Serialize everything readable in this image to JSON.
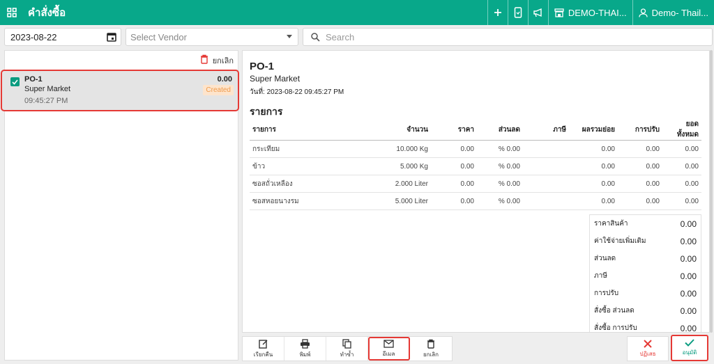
{
  "header": {
    "title": "คำสั่งซื้อ",
    "store": "DEMO-THAI...",
    "user": "Demo- Thail..."
  },
  "filters": {
    "date": "2023-08-22",
    "vendor_placeholder": "Select Vendor",
    "search_placeholder": "Search"
  },
  "list": {
    "cancel_label": "ยกเลิก",
    "items": [
      {
        "id": "PO-1",
        "vendor": "Super Market",
        "time": "09:45:27 PM",
        "amount": "0.00",
        "status": "Created"
      }
    ]
  },
  "detail": {
    "po_id": "PO-1",
    "vendor": "Super Market",
    "date": "วันที่: 2023-08-22 09:45:27 PM",
    "section_title": "รายการ",
    "columns": [
      "รายการ",
      "จำนวน",
      "ราคา",
      "ส่วนลด",
      "ภาษี",
      "ผลรวมย่อย",
      "การปรับ",
      "ยอดทั้งหมด"
    ],
    "rows": [
      [
        "กระเทียม",
        "10.000 Kg",
        "0.00",
        "% 0.00",
        "",
        "0.00",
        "0.00",
        "0.00"
      ],
      [
        "ข้าว",
        "5.000 Kg",
        "0.00",
        "% 0.00",
        "",
        "0.00",
        "0.00",
        "0.00"
      ],
      [
        "ซอสถั่วเหลือง",
        "2.000 Liter",
        "0.00",
        "% 0.00",
        "",
        "0.00",
        "0.00",
        "0.00"
      ],
      [
        "ซอสหอยนางรม",
        "5.000 Liter",
        "0.00",
        "% 0.00",
        "",
        "0.00",
        "0.00",
        "0.00"
      ]
    ],
    "summary": [
      {
        "label": "ราคาสินค้า",
        "value": "0.00"
      },
      {
        "label": "ค่าใช้จ่ายเพิ่มเติม",
        "value": "0.00"
      },
      {
        "label": "ส่วนลด",
        "value": "0.00"
      },
      {
        "label": "ภาษี",
        "value": "0.00"
      },
      {
        "label": "การปรับ",
        "value": "0.00"
      },
      {
        "label": "สั่งซื้อ ส่วนลด",
        "value": "0.00"
      },
      {
        "label": "สั่งซื้อ การปรับ",
        "value": "0.00"
      }
    ]
  },
  "toolbar": {
    "recall": "เรียกคืน",
    "print": "พิมพ์",
    "duplicate": "ทำซ้ำ",
    "email": "อีเมล",
    "cancel": "ยกเลิก",
    "reject": "ปฏิเสธ",
    "approve": "อนุมัติ"
  },
  "colors": {
    "brand": "#08a88a",
    "highlight": "#e53935",
    "status_bg": "#fde4cc",
    "status_text": "#f09a4a"
  }
}
